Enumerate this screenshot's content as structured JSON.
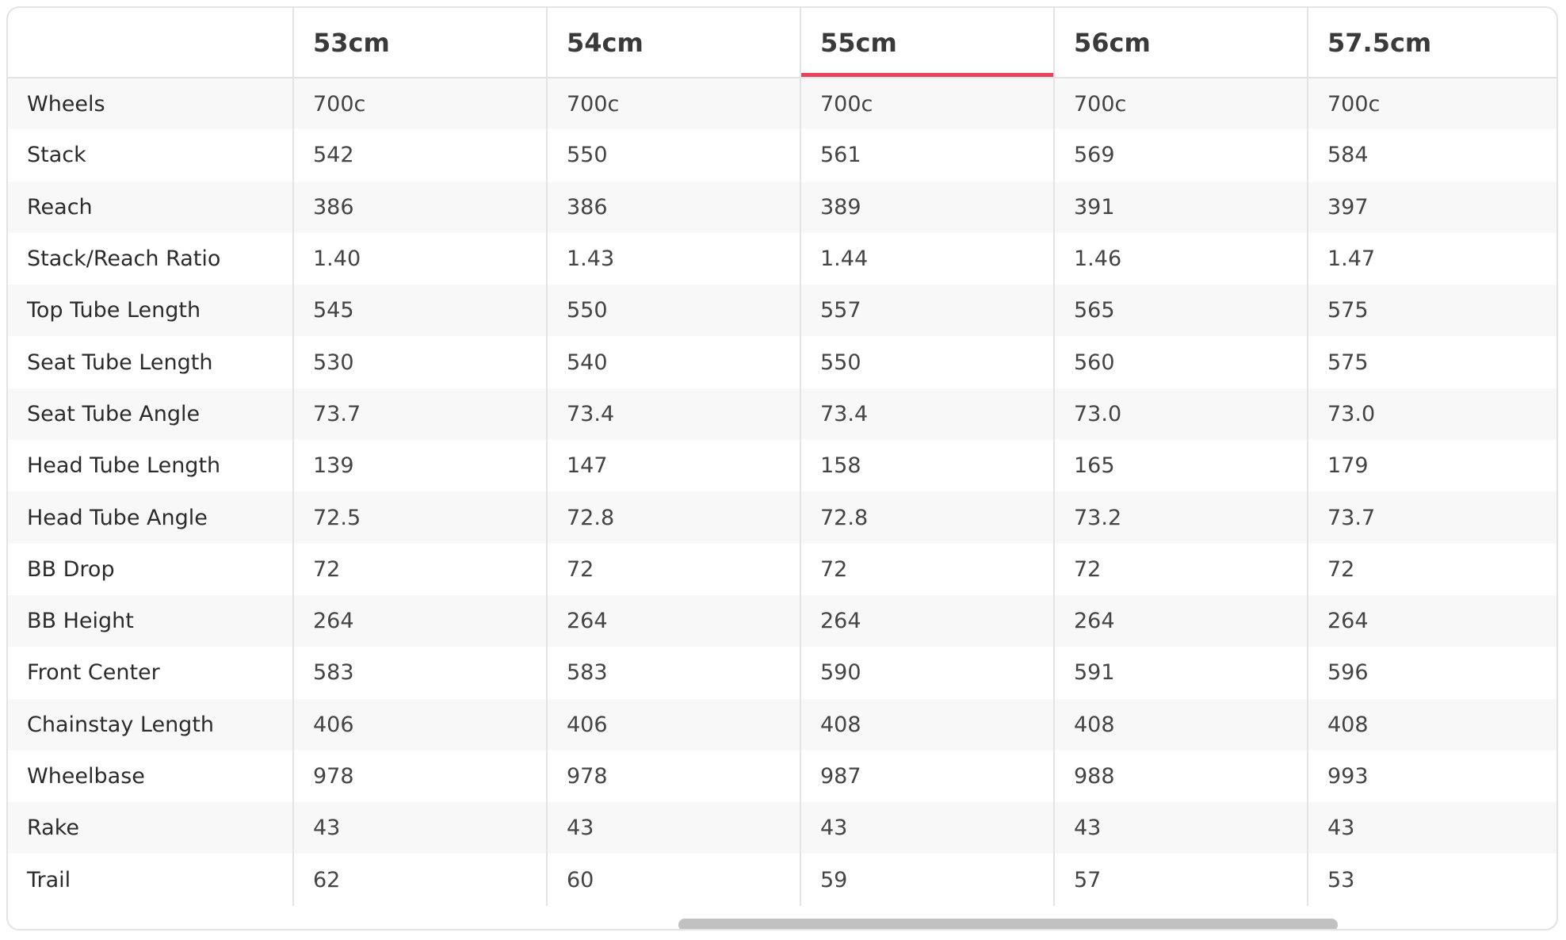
{
  "header": {
    "corner_label": "",
    "sizes": [
      "53cm",
      "54cm",
      "55cm",
      "56cm",
      "57.5cm"
    ],
    "selected_size": "55cm",
    "accent_color": "#e8425c"
  },
  "rows": [
    {
      "label": "Wheels",
      "values": [
        "700c",
        "700c",
        "700c",
        "700c",
        "700c"
      ]
    },
    {
      "label": "Stack",
      "values": [
        "542",
        "550",
        "561",
        "569",
        "584"
      ]
    },
    {
      "label": "Reach",
      "values": [
        "386",
        "386",
        "389",
        "391",
        "397"
      ]
    },
    {
      "label": "Stack/Reach Ratio",
      "values": [
        "1.40",
        "1.43",
        "1.44",
        "1.46",
        "1.47"
      ]
    },
    {
      "label": "Top Tube Length",
      "values": [
        "545",
        "550",
        "557",
        "565",
        "575"
      ]
    },
    {
      "label": "Seat Tube Length",
      "values": [
        "530",
        "540",
        "550",
        "560",
        "575"
      ]
    },
    {
      "label": "Seat Tube Angle",
      "values": [
        "73.7",
        "73.4",
        "73.4",
        "73.0",
        "73.0"
      ]
    },
    {
      "label": "Head Tube Length",
      "values": [
        "139",
        "147",
        "158",
        "165",
        "179"
      ]
    },
    {
      "label": "Head Tube Angle",
      "values": [
        "72.5",
        "72.8",
        "72.8",
        "73.2",
        "73.7"
      ]
    },
    {
      "label": "BB Drop",
      "values": [
        "72",
        "72",
        "72",
        "72",
        "72"
      ]
    },
    {
      "label": "BB Height",
      "values": [
        "264",
        "264",
        "264",
        "264",
        "264"
      ]
    },
    {
      "label": "Front Center",
      "values": [
        "583",
        "583",
        "590",
        "591",
        "596"
      ]
    },
    {
      "label": "Chainstay Length",
      "values": [
        "406",
        "406",
        "408",
        "408",
        "408"
      ]
    },
    {
      "label": "Wheelbase",
      "values": [
        "978",
        "978",
        "987",
        "988",
        "993"
      ]
    },
    {
      "label": "Rake",
      "values": [
        "43",
        "43",
        "43",
        "43",
        "43"
      ]
    },
    {
      "label": "Trail",
      "values": [
        "62",
        "60",
        "59",
        "57",
        "53"
      ]
    }
  ]
}
